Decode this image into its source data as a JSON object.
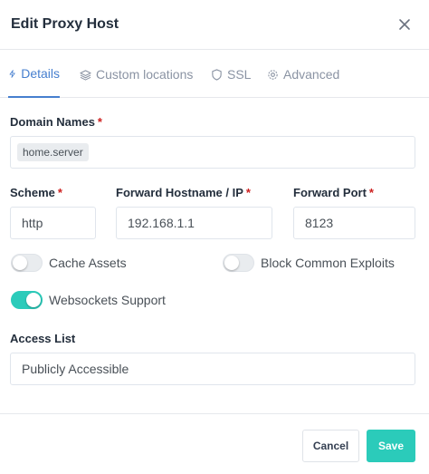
{
  "modal": {
    "title": "Edit Proxy Host"
  },
  "tabs": [
    {
      "label": "Details",
      "icon": "bolt-icon",
      "active": true
    },
    {
      "label": "Custom locations",
      "icon": "layers-icon",
      "active": false
    },
    {
      "label": "SSL",
      "icon": "shield-icon",
      "active": false
    },
    {
      "label": "Advanced",
      "icon": "gear-icon",
      "active": false
    }
  ],
  "form": {
    "domain_names": {
      "label": "Domain Names",
      "required_mark": "*",
      "tags": [
        "home.server"
      ]
    },
    "scheme": {
      "label": "Scheme",
      "required_mark": "*",
      "value": "http"
    },
    "forward_host": {
      "label": "Forward Hostname / IP",
      "required_mark": "*",
      "value": "192.168.1.1"
    },
    "forward_port": {
      "label": "Forward Port",
      "required_mark": "*",
      "value": "8123"
    },
    "cache_assets": {
      "label": "Cache Assets",
      "enabled": false
    },
    "block_exploits": {
      "label": "Block Common Exploits",
      "enabled": false
    },
    "websockets": {
      "label": "Websockets Support",
      "enabled": true
    },
    "access_list": {
      "label": "Access List",
      "value": "Publicly Accessible"
    }
  },
  "footer": {
    "cancel_label": "Cancel",
    "save_label": "Save"
  },
  "colors": {
    "accent": "#467fcf",
    "teal": "#2bcbba",
    "required": "#cd201f"
  }
}
